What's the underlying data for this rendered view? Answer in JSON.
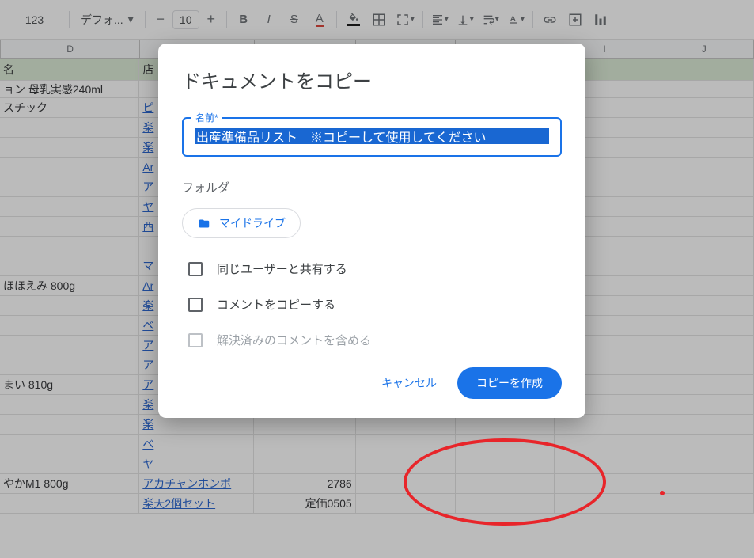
{
  "toolbar": {
    "format_label": "123",
    "font_name": "デフォ...",
    "font_size": "10"
  },
  "columns": [
    "D",
    "E",
    "F",
    "G",
    "H",
    "I",
    "J"
  ],
  "header_row": {
    "D": "名",
    "E": "店"
  },
  "rows": [
    {
      "D": "ョン 母乳実感240ml",
      "E": ""
    },
    {
      "D": "スチック",
      "E": "ピ",
      "link": true
    },
    {
      "D": "",
      "E": "楽",
      "link": true
    },
    {
      "D": "",
      "E": "楽",
      "link": true
    },
    {
      "D": "",
      "E": "Ar",
      "link": true
    },
    {
      "D": "",
      "E": "ア",
      "link": true
    },
    {
      "D": "",
      "E": "ヤ",
      "link": true
    },
    {
      "D": "",
      "E": "西",
      "link": true
    },
    {
      "D": "",
      "E": ""
    },
    {
      "D": "",
      "E": "マ",
      "link": true
    },
    {
      "D": "ほほえみ 800g",
      "E": "Ar",
      "link": true
    },
    {
      "D": "",
      "E": "楽",
      "link": true
    },
    {
      "D": "",
      "E": "ベ",
      "link": true
    },
    {
      "D": "",
      "E": "ア",
      "link": true
    },
    {
      "D": "",
      "E": "ア",
      "link": true
    },
    {
      "D": "まい 810g",
      "E": "ア",
      "link": true
    },
    {
      "D": "",
      "E": "楽",
      "link": true
    },
    {
      "D": "",
      "E": "楽",
      "link": true
    },
    {
      "D": "",
      "E": "ベ",
      "link": true
    },
    {
      "D": "",
      "E": "ヤ",
      "link": true
    },
    {
      "D": "やかM1 800g",
      "E": "アカチャンホンポ",
      "F": "2786",
      "link": true
    },
    {
      "D": "",
      "E": "楽天2個セット",
      "F": "定価0505",
      "link": true
    }
  ],
  "dialog": {
    "title": "ドキュメントをコピー",
    "name_legend": "名前*",
    "name_value": "出産準備品リスト　※コピーして使用してください",
    "folder_label": "フォルダ",
    "folder_chip": "マイドライブ",
    "check_share": "同じユーザーと共有する",
    "check_comments": "コメントをコピーする",
    "check_resolved": "解決済みのコメントを含める",
    "cancel": "キャンセル",
    "submit": "コピーを作成"
  }
}
